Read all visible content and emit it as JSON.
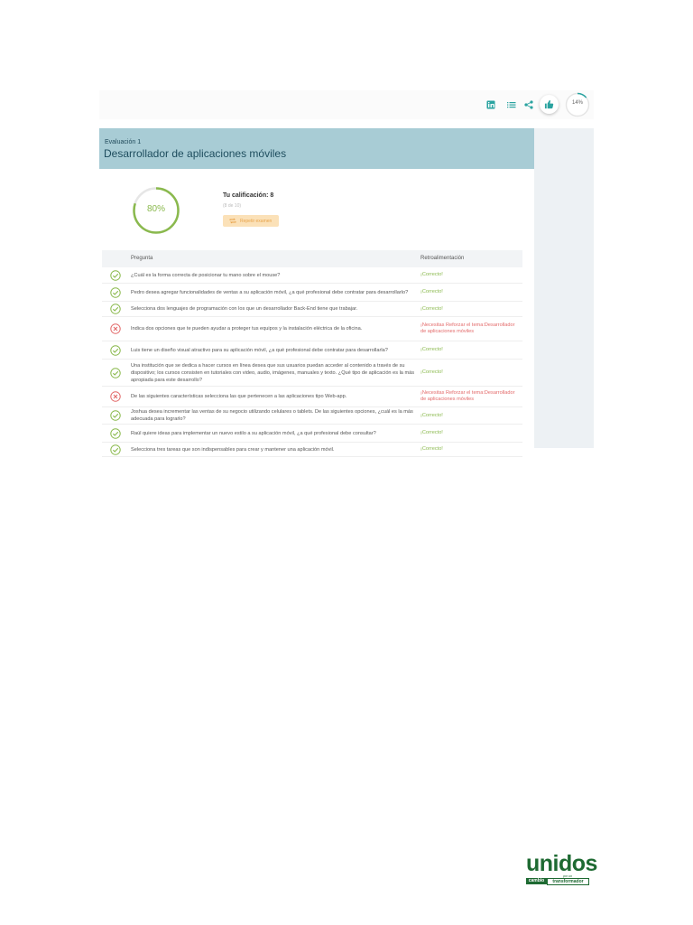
{
  "header": {
    "kicker": "Evaluación 1",
    "title": "Desarrollador de aplicaciones móviles"
  },
  "topbar": {
    "icons": [
      "linkedin-icon",
      "list-icon",
      "share-icon",
      "thumbs-up-icon"
    ],
    "progress_label": "14%",
    "progress_value": 0.14
  },
  "score": {
    "percent_label": "80%",
    "percent_value": 0.8,
    "title": "Tu calificación: 8",
    "subtitle": "(8 de 10)",
    "retry_label": "Repetir examen"
  },
  "table": {
    "col_question": "Pregunta",
    "col_feedback": "Retroalimentación",
    "rows": [
      {
        "status": "correct",
        "question": "¿Cuál es la forma correcta de posicionar tu mano sobre el mouse?",
        "feedback": "¡Correcto!"
      },
      {
        "status": "correct",
        "question": "Pedro desea agregar funcionalidades de ventas a su aplicación móvil, ¿a qué profesional debe contratar para desarrollarlo?",
        "feedback": "¡Correcto!"
      },
      {
        "status": "correct",
        "question": "Selecciona dos lenguajes de programación con los que un desarrollador Back-End tiene que trabajar.",
        "feedback": "¡Correcto!"
      },
      {
        "status": "wrong",
        "question": "Indica dos opciones que te pueden ayudar a proteger tus equipos y la instalación eléctrica de la oficina.",
        "feedback": "¡Necesitas Reforzar el tema:Desarrollador de aplicaciones móviles"
      },
      {
        "status": "correct",
        "question": "Luis tiene un diseño visual atractivo para su aplicación móvil, ¿a qué profesional debe contratar para desarrollarla?",
        "feedback": "¡Correcto!"
      },
      {
        "status": "correct",
        "question": "Una institución que se dedica a hacer cursos en línea desea que sus usuarios puedan acceder al contenido a través de su dispositivo; los cursos consisten en tutoriales con video, audio, imágenes, manuales y texto. ¿Qué tipo de aplicación es la más apropiada para este desarrollo?",
        "feedback": "¡Correcto!"
      },
      {
        "status": "wrong",
        "question": "De las siguientes características selecciona las que pertenecen a las aplicaciones tipo Web-app.",
        "feedback": "¡Necesitas Reforzar el tema:Desarrollador de aplicaciones móviles"
      },
      {
        "status": "correct",
        "question": "Joshua desea incrementar las ventas de su negocio utilizando celulares o tablets. De las siguientes opciones, ¿cuál es la más adecuada para lograrlo?",
        "feedback": "¡Correcto!"
      },
      {
        "status": "correct",
        "question": "Raúl quiere ideas para implementar un nuevo estilo a su aplicación móvil, ¿a qué profesional debe consultar?",
        "feedback": "¡Correcto!"
      },
      {
        "status": "correct",
        "question": "Selecciona tres tareas que son indispensables para crear y mantener una aplicación móvil.",
        "feedback": "¡Correcto!"
      }
    ]
  },
  "logo": {
    "word": "unidos",
    "mini": "por un",
    "band_left": "cambio",
    "band_right": "transformador"
  },
  "colors": {
    "header_band": "#a8ccd5",
    "ok": "#8ab94d",
    "bad": "#e36a6a",
    "teal": "#2aa3a0",
    "brand_green": "#1e6a32"
  }
}
